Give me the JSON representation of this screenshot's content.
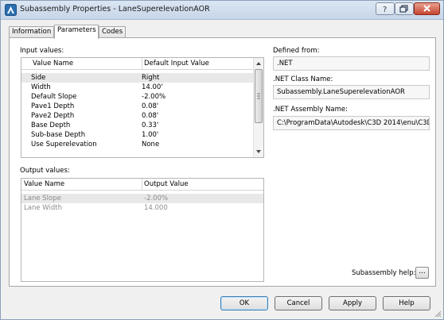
{
  "window": {
    "title": "Subassembly Properties - LaneSuperelevationAOR"
  },
  "tabs": [
    {
      "label": "Information",
      "active": false
    },
    {
      "label": "Parameters",
      "active": true
    },
    {
      "label": "Codes",
      "active": false
    }
  ],
  "input_values": {
    "label": "Input values:",
    "columns": [
      "Value Name",
      "Default Input Value"
    ],
    "rows": [
      {
        "name": "Side",
        "value": "Right",
        "selected": true
      },
      {
        "name": "Width",
        "value": "14.00'"
      },
      {
        "name": "Default Slope",
        "value": "-2.00%"
      },
      {
        "name": "Pave1 Depth",
        "value": "0.08'"
      },
      {
        "name": "Pave2 Depth",
        "value": "0.08'"
      },
      {
        "name": "Base Depth",
        "value": "0.33'"
      },
      {
        "name": "Sub-base Depth",
        "value": "1.00'"
      },
      {
        "name": "Use Superelevation",
        "value": "None"
      }
    ]
  },
  "output_values": {
    "label": "Output values:",
    "columns": [
      "Value Name",
      "Output Value"
    ],
    "rows": [
      {
        "name": "Lane Slope",
        "value": "-2.00%"
      },
      {
        "name": "Lane Width",
        "value": "14.000"
      }
    ]
  },
  "defined_from": {
    "label": "Defined from:",
    "value": ".NET"
  },
  "class_name": {
    "label": ".NET Class Name:",
    "value": "Subassembly.LaneSuperelevationAOR"
  },
  "assembly_name": {
    "label": ".NET Assembly Name:",
    "value": "C:\\ProgramData\\Autodesk\\C3D 2014\\enu\\C3DS"
  },
  "subassembly_help": {
    "label": "Subassembly help:",
    "button": "..."
  },
  "buttons": {
    "ok": "OK",
    "cancel": "Cancel",
    "apply": "Apply",
    "help": "Help"
  },
  "colors": {
    "accent": "#3c7fb1",
    "title_gradient_top": "#dbe6f3",
    "close_red": "#c5452f",
    "disabled_text": "#8c8c8c"
  }
}
